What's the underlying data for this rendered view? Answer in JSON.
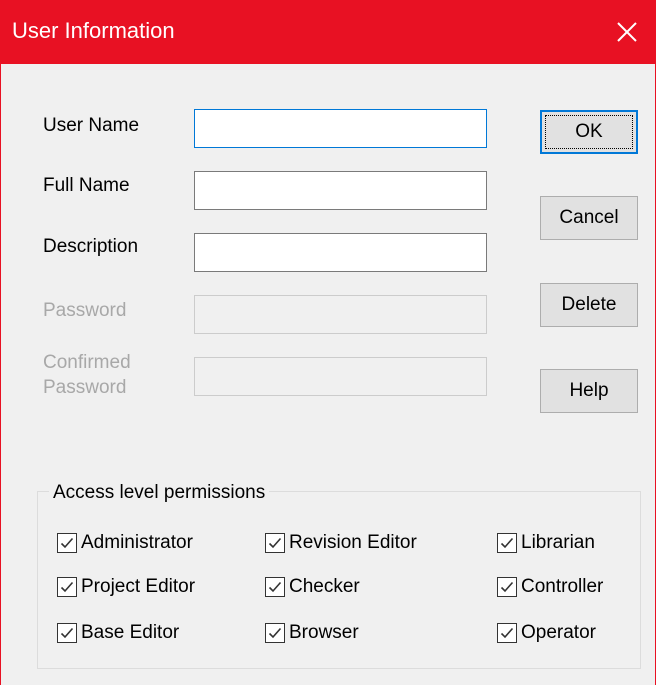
{
  "window": {
    "title": "User Information"
  },
  "fields": {
    "user_name": {
      "label": "User Name",
      "value": ""
    },
    "full_name": {
      "label": "Full Name",
      "value": ""
    },
    "description": {
      "label": "Description",
      "value": ""
    },
    "password": {
      "label": "Password",
      "value": ""
    },
    "confirmed_password": {
      "label_line1": "Confirmed",
      "label_line2": "Password",
      "value": ""
    }
  },
  "buttons": {
    "ok": "OK",
    "cancel": "Cancel",
    "delete": "Delete",
    "help": "Help"
  },
  "permissions": {
    "group_label": "Access level permissions",
    "items": [
      {
        "label": "Administrator",
        "checked": true
      },
      {
        "label": "Revision Editor",
        "checked": true
      },
      {
        "label": "Librarian",
        "checked": true
      },
      {
        "label": "Project Editor",
        "checked": true
      },
      {
        "label": "Checker",
        "checked": true
      },
      {
        "label": "Controller",
        "checked": true
      },
      {
        "label": "Base Editor",
        "checked": true
      },
      {
        "label": "Browser",
        "checked": true
      },
      {
        "label": "Operator",
        "checked": true
      }
    ]
  },
  "icons": {
    "close": "close-icon",
    "check": "checkmark-icon"
  },
  "colors": {
    "titlebar": "#e81123",
    "focus_accent": "#0078d7",
    "dialog_bg": "#f0f0f0"
  }
}
